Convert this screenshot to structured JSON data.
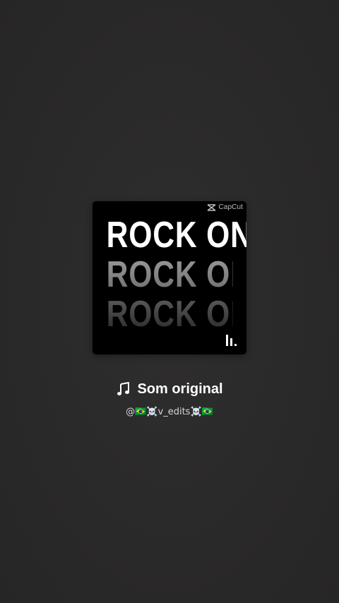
{
  "cover": {
    "watermark": "CapCut",
    "lines": [
      "ROCK ON",
      "ROCK ON",
      "ROCK ON"
    ],
    "brand_icon": "bars-logo-icon"
  },
  "sound": {
    "icon": "music-note-icon",
    "title": "Som original",
    "author": "@🇧🇷☠️v_edits☠️🇧🇷"
  },
  "colors": {
    "background": "#2b2a2a",
    "title": "#ffffff",
    "author": "#d6d6d6"
  }
}
